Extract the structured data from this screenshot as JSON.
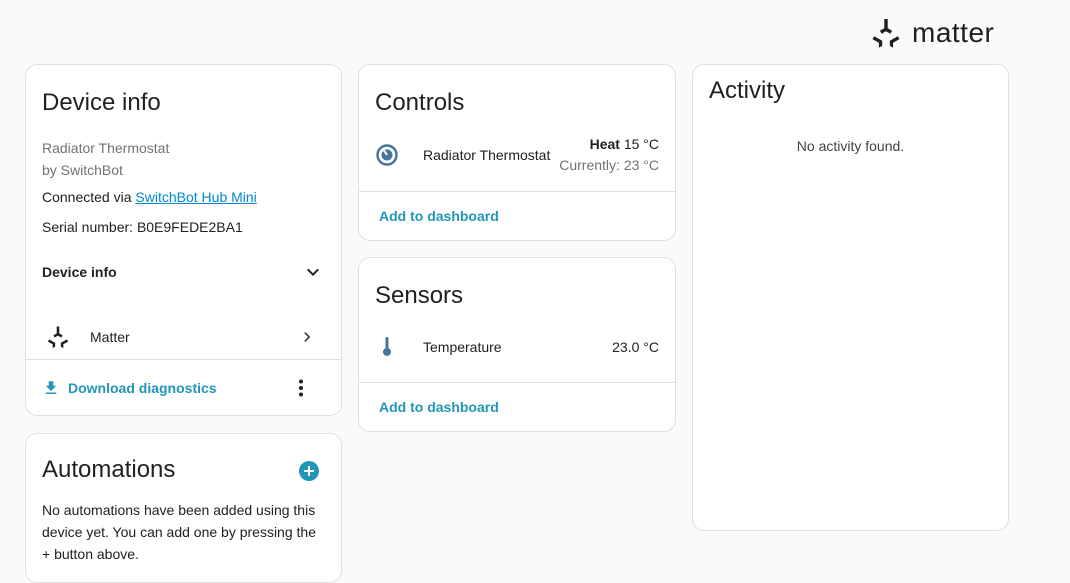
{
  "brand": {
    "name": "matter",
    "icon": "matter-logo-icon"
  },
  "device_info": {
    "title": "Device info",
    "model": "Radiator Thermostat",
    "manufacturer": "by SwitchBot",
    "connected_via_label": "Connected via ",
    "connected_via_link": "SwitchBot Hub Mini",
    "serial_label": "Serial number: ",
    "serial_value": "B0E9FEDE2BA1",
    "expander_label": "Device info",
    "integration": {
      "name": "Matter",
      "icon": "matter-logo-icon"
    },
    "download_label": "Download diagnostics"
  },
  "automations": {
    "title": "Automations",
    "empty_text": "No automations have been added using this device yet. You can add one by pressing the + button above."
  },
  "controls": {
    "title": "Controls",
    "entity": {
      "name": "Radiator Thermostat",
      "icon": "thermostat-icon",
      "mode": "Heat",
      "target": "15 °C",
      "current": "Currently: 23 °C"
    },
    "add_label": "Add to dashboard"
  },
  "sensors": {
    "title": "Sensors",
    "entity": {
      "name": "Temperature",
      "icon": "thermometer-icon",
      "value": "23.0 °C"
    },
    "add_label": "Add to dashboard"
  },
  "activity": {
    "title": "Activity",
    "empty_text": "No activity found."
  },
  "colors": {
    "accent": "#2196b8",
    "link": "#0288d1",
    "icon": "#44739e"
  }
}
